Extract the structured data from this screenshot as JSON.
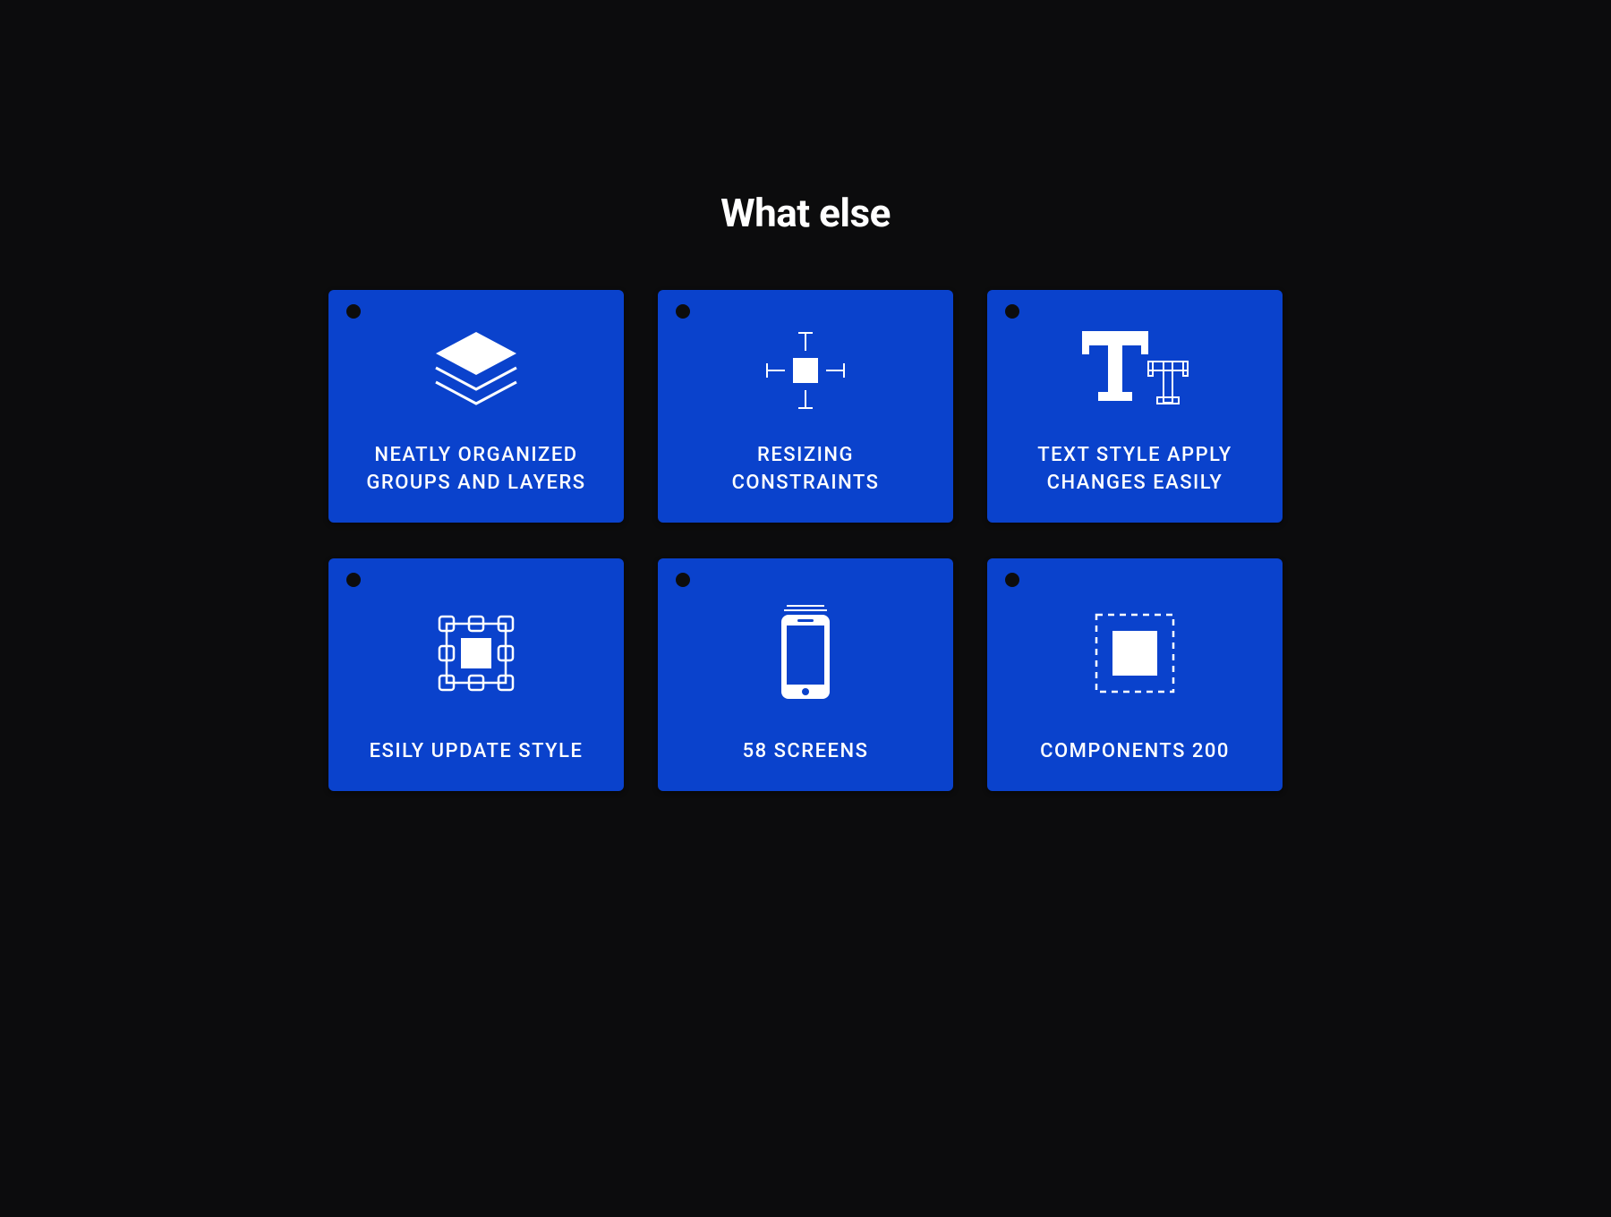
{
  "heading": "What else",
  "colors": {
    "background": "#0c0c0d",
    "card": "#0a42cc",
    "text": "#ffffff"
  },
  "cards": [
    {
      "icon": "layers-icon",
      "label": "NEATLY ORGANIZED\nGROUPS AND LAYERS"
    },
    {
      "icon": "resize-icon",
      "label": "RESIZING\nCONSTRAINTS"
    },
    {
      "icon": "text-style-icon",
      "label": "TEXT STYLE APPLY\nCHANGES EASILY"
    },
    {
      "icon": "style-edit-icon",
      "label": "ESILY UPDATE STYLE"
    },
    {
      "icon": "phone-icon",
      "label": "58 SCREENS"
    },
    {
      "icon": "component-icon",
      "label": "COMPONENTS 200"
    }
  ]
}
